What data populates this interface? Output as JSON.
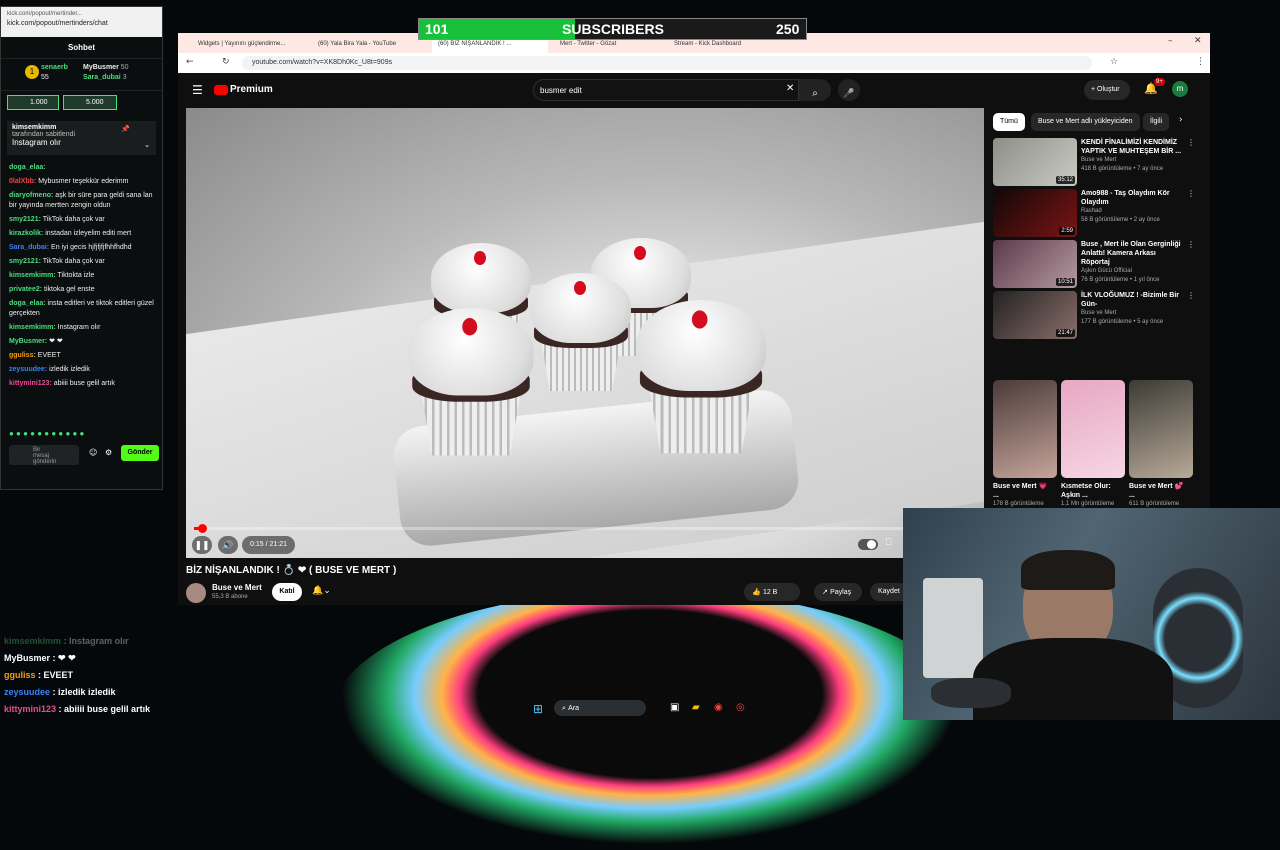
{
  "sub_goal": {
    "current": "101",
    "label": "SUBSCRIBERS",
    "goal": "250",
    "progress": 0.404
  },
  "kick": {
    "url": "kick.com/popout/mertinders/chat",
    "window_title": "kick.com/popout/mertinder...",
    "header": "Sohbet",
    "leaders": [
      {
        "name": "senaerb",
        "count": "55"
      },
      {
        "name": "MyBusmer",
        "count": "50"
      },
      {
        "name": "Sara_dubai",
        "count": "3"
      }
    ],
    "gifts": [
      "1.000",
      "5.000"
    ],
    "pinned_by": "kimsemkimm",
    "pinned_label": "tarafından sabitlendi",
    "pinned_text": "Instagram olır",
    "messages": [
      {
        "user": "doga_elaa:",
        "text": "",
        "color": "#4ade80"
      },
      {
        "user": "0lalXbb:",
        "text": "Mybusmer teşekkür ederimm",
        "color": "#ef4444"
      },
      {
        "user": "diaryofmeno:",
        "text": "aşk bir süre para geldi sana lan bir yayında mertten zengin oldun",
        "color": "#4ade80"
      },
      {
        "user": "smy2121:",
        "text": "TikTok daha çok var",
        "color": "#4ade80"
      },
      {
        "user": "kirazkolik:",
        "text": "instadan izleyelim editi mert",
        "color": "#4ade80"
      },
      {
        "user": "Sara_dubai:",
        "text": "En iyi gecis hjfjfjfjfhhfhdhd",
        "color": "#3b82f6"
      },
      {
        "user": "smy2121:",
        "text": "TikTok daha çok var",
        "color": "#4ade80"
      },
      {
        "user": "kimsemkimm:",
        "text": "Tiktokta izle",
        "color": "#4ade80"
      },
      {
        "user": "privatee2:",
        "text": "tiktoka gel enste",
        "color": "#4ade80"
      },
      {
        "user": "doga_elaa:",
        "text": "insta editleri ve tiktok editleri güzel gerçekten",
        "color": "#4ade80"
      },
      {
        "user": "kimsemkimm:",
        "text": "Instagram olır",
        "color": "#4ade80"
      },
      {
        "user": "MyBusmer:",
        "text": "❤ ❤",
        "color": "#4ade80"
      },
      {
        "user": "gguliss:",
        "text": "EVEET",
        "color": "#f59e0b"
      },
      {
        "user": "zeysuudee:",
        "text": "izledik izledik",
        "color": "#3b82f6"
      },
      {
        "user": "kittymini123:",
        "text": "abiiii buse gelil artık",
        "color": "#ec4899"
      }
    ],
    "input_placeholder": "Bir mesaj gönderin",
    "send_label": "Gönder"
  },
  "overlay_chat": [
    {
      "user": "kimsemkimm",
      "text": ": Instagram olır",
      "color": "#4ade80"
    },
    {
      "user": "MyBusmer",
      "text": ": ❤ ❤",
      "color": "#ffffff"
    },
    {
      "user": "gguliss",
      "text": ": EVEET",
      "color": "#f59e0b"
    },
    {
      "user": "zeysuudee",
      "text": ": izledik izledik",
      "color": "#3b82f6"
    },
    {
      "user": "kittymini123",
      "text": ": abiiii buse gelil artık",
      "color": "#ec4899"
    }
  ],
  "browser": {
    "tabs": [
      "Widgets | Yayınını güçlendirme...",
      "(60) Yala Bira Yala - YouTube",
      "(60) BİZ NİŞANLANDIK ! ...",
      "Mert - Twitter - Gözat",
      "Stream - Kick Dashboard"
    ],
    "url": "youtube.com/watch?v=XK8Dh0Kc_U8t=909s"
  },
  "youtube": {
    "logo": "Premium",
    "search_value": "busmer edit",
    "create_label": "Oluştur",
    "notif_count": "9+",
    "avatar_letter": "m",
    "time": "0:15 / 21:21",
    "title": "BİZ NİŞANLANDIK ! 💍 ❤ ( BUSE VE MERT )",
    "channel": "Buse ve Mert",
    "subs": "55,3 B abone",
    "join_label": "Katıl",
    "likes": "12 B",
    "share_label": "Paylaş",
    "save_label": "Kaydet",
    "chips": [
      "Tümü",
      "Buse ve Mert adlı yükleyiciden",
      "İlgili"
    ],
    "recs": [
      {
        "title": "KENDİ FİNALİMİZİ KENDİMİZ YAPTIK VE MUHTEŞEM BİR ...",
        "channel": "Buse ve Mert",
        "meta": "418 B görüntüleme • 7 ay önce",
        "dur": "35:12",
        "c1": "#8d8f87",
        "c2": "#c9cbc4"
      },
      {
        "title": "Amo988 - Taş Olaydım Kör Olaydım",
        "channel": "Rashad",
        "meta": "58 B görüntüleme • 2 ay önce",
        "dur": "2:59",
        "c1": "#120708",
        "c2": "#7a1513"
      },
      {
        "title": "Buse , Mert ile Olan Gerginliği Anlattı! Kamera Arkası Röportaj",
        "channel": "Aşkın Gücü Official",
        "meta": "76 B görüntüleme • 1 yıl önce",
        "dur": "10:51",
        "c1": "#5a3a4a",
        "c2": "#b59aa0"
      },
      {
        "title": "İLK VLOĞUMUZ ! -Bizimle Bir Gün-",
        "channel": "Buse ve Mert",
        "meta": "177 B görüntüleme • 5 ay önce",
        "dur": "21:47",
        "c1": "#222",
        "c2": "#8a6f6a"
      }
    ],
    "shorts": [
      {
        "title": "Buse ve Mert 💗 ...",
        "meta": "178 B görüntüleme",
        "c1": "#4b3b39",
        "c2": "#c5a49a"
      },
      {
        "title": "Kısmetse Olur: Aşkın ...",
        "meta": "1,1 Mn görüntüleme",
        "c1": "#e7a7c3",
        "c2": "#f6d6e3"
      },
      {
        "title": "Buse ve Mert 💕 ...",
        "meta": "611 B görüntüleme",
        "c1": "#3d3b36",
        "c2": "#b7aa98"
      }
    ]
  },
  "taskbar": {
    "search": "Ara"
  }
}
